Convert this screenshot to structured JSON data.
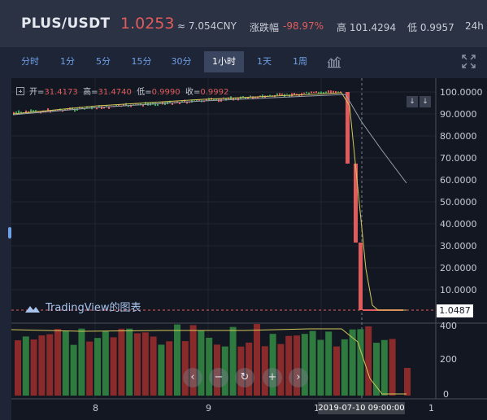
{
  "header": {
    "pair": "PLUS/USDT",
    "price": "1.0253",
    "cny": "≈ 7.054CNY",
    "change_label": "涨跌幅",
    "change_value": "-98.97%",
    "high": "高 101.4294",
    "low": "低 0.9957",
    "h24": "24h"
  },
  "toolbar": {
    "tabs": [
      "分时",
      "1分",
      "5分",
      "15分",
      "30分",
      "1小时",
      "1天",
      "1周"
    ],
    "active_tab": "1小时",
    "chart_type_icon": "indicators-icon",
    "expand_icon": "fullscreen-icon"
  },
  "legend": {
    "open_label": "开=",
    "open": "31.4173",
    "high_label": "高=",
    "high": "31.4740",
    "low_label": "低=",
    "low": "0.9990",
    "close_label": "收=",
    "close": "0.9992"
  },
  "watermark": "TradingView的图表",
  "price_axis": [
    "100.0000",
    "90.0000",
    "80.0000",
    "70.0000",
    "60.0000",
    "50.0000",
    "40.0000",
    "30.0000",
    "20.0000",
    "10.0000"
  ],
  "last_price": "1.0487",
  "volume_axis": [
    "400",
    "200",
    "0"
  ],
  "time_axis": [
    "8",
    "9",
    "1",
    "1"
  ],
  "crosshair_time": "2019-07-10 09:00:00",
  "nav_buttons": [
    "‹",
    "−",
    "↻",
    "+",
    "›"
  ],
  "colors": {
    "up": "#3fa35a",
    "down": "#e05c5c",
    "accent": "#6fa0e8"
  }
}
